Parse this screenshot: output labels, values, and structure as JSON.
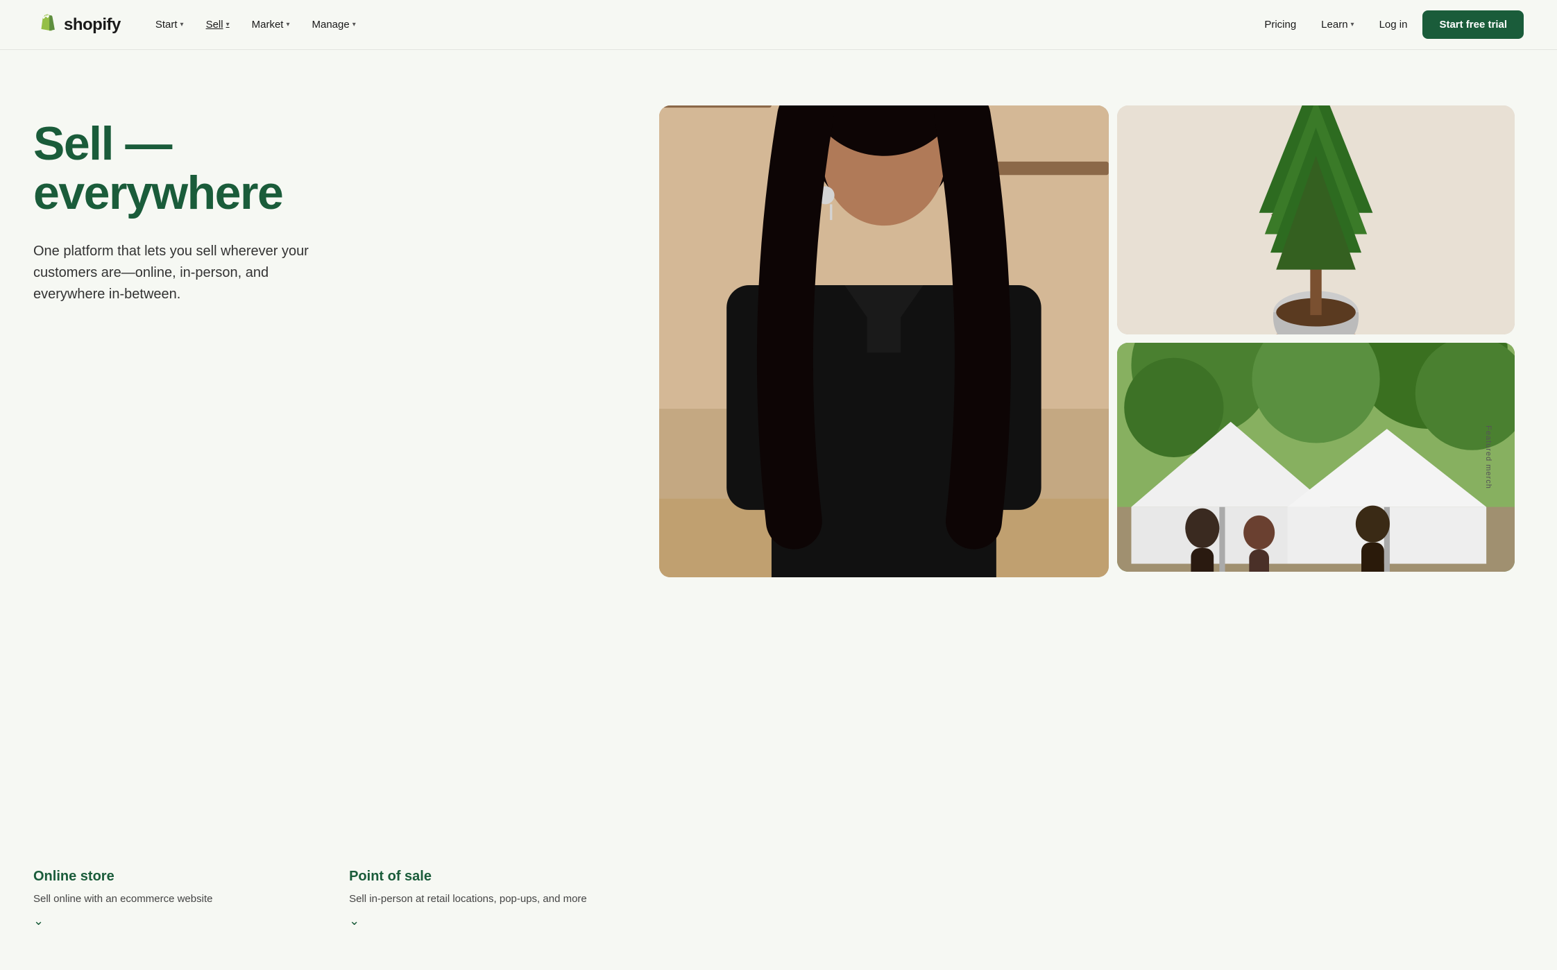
{
  "brand": {
    "name": "shopify",
    "logo_alt": "Shopify logo"
  },
  "nav": {
    "links": [
      {
        "label": "Start",
        "has_dropdown": true,
        "active": false
      },
      {
        "label": "Sell",
        "has_dropdown": true,
        "active": true
      },
      {
        "label": "Market",
        "has_dropdown": true,
        "active": false
      },
      {
        "label": "Manage",
        "has_dropdown": true,
        "active": false
      }
    ],
    "right_links": [
      {
        "label": "Pricing",
        "has_dropdown": false
      },
      {
        "label": "Learn",
        "has_dropdown": true
      }
    ],
    "login_label": "Log in",
    "cta_label": "Start free trial"
  },
  "hero": {
    "title_line1": "Sell —",
    "title_line2": "everywhere",
    "description": "One platform that lets you sell wherever your customers are—online, in-person, and everywhere in-between.",
    "cards": [
      {
        "title": "Online store",
        "description": "Sell online with an ecommerce website"
      },
      {
        "title": "Point of sale",
        "description": "Sell in-person at retail locations, pop-ups, and more"
      }
    ]
  },
  "sidebar": {
    "featured_label": "Featured merch"
  },
  "colors": {
    "brand_green": "#1a5c3a",
    "bg": "#f6f8f3",
    "cta_bg": "#1a5c3a",
    "cta_text": "#ffffff"
  }
}
